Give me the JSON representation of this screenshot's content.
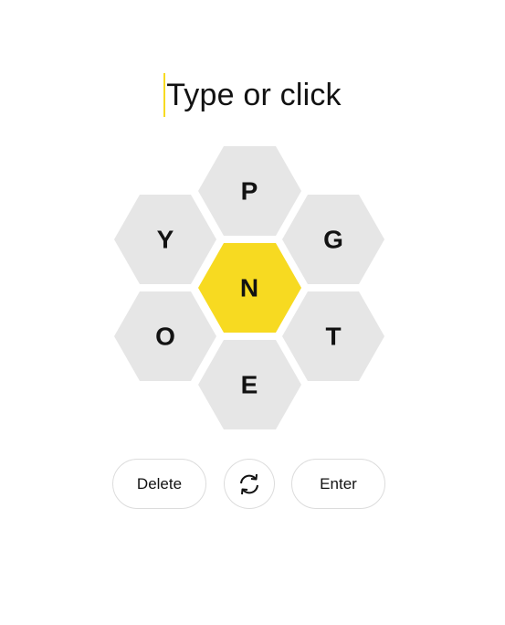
{
  "input": {
    "placeholder": "Type or click"
  },
  "hive": {
    "center_letter": "N",
    "outer_letters": [
      "P",
      "G",
      "T",
      "E",
      "O",
      "Y"
    ],
    "center_color": "#f7da21",
    "outer_color": "#e6e6e6"
  },
  "controls": {
    "delete_label": "Delete",
    "shuffle_icon": "shuffle-icon",
    "enter_label": "Enter"
  }
}
